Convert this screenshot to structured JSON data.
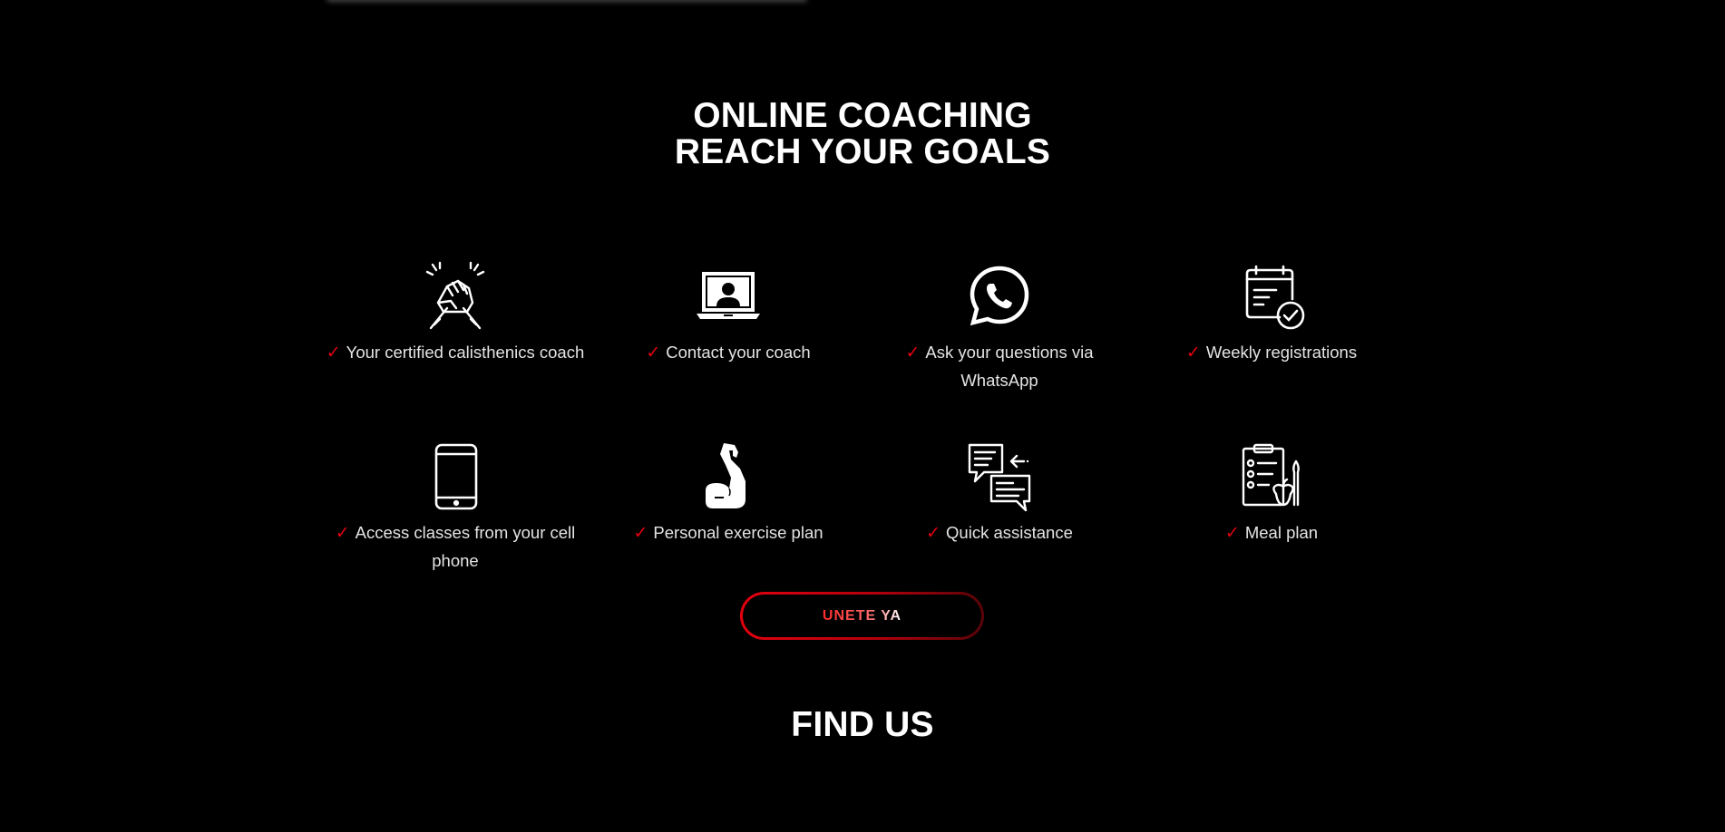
{
  "section": {
    "title_line1": "ONLINE COACHING",
    "title_line2": "REACH YOUR GOALS"
  },
  "features": [
    {
      "icon": "handshake-arm-wrestling-icon",
      "label": "Your certified calisthenics coach"
    },
    {
      "icon": "laptop-video-call-icon",
      "label": "Contact your coach"
    },
    {
      "icon": "whatsapp-icon",
      "label": "Ask your questions via WhatsApp"
    },
    {
      "icon": "calendar-check-icon",
      "label": "Weekly registrations"
    },
    {
      "icon": "smartphone-icon",
      "label": "Access classes from your cell phone"
    },
    {
      "icon": "flexed-bicep-icon",
      "label": "Personal exercise plan"
    },
    {
      "icon": "chat-bubbles-icon",
      "label": "Quick assistance"
    },
    {
      "icon": "meal-plan-clipboard-icon",
      "label": "Meal plan"
    }
  ],
  "check_mark": "✓",
  "cta": {
    "label": "UNETE YA"
  },
  "find_us": {
    "title": "FIND US"
  },
  "colors": {
    "background": "#000000",
    "accent": "#e3000f",
    "text": "#ffffff"
  }
}
